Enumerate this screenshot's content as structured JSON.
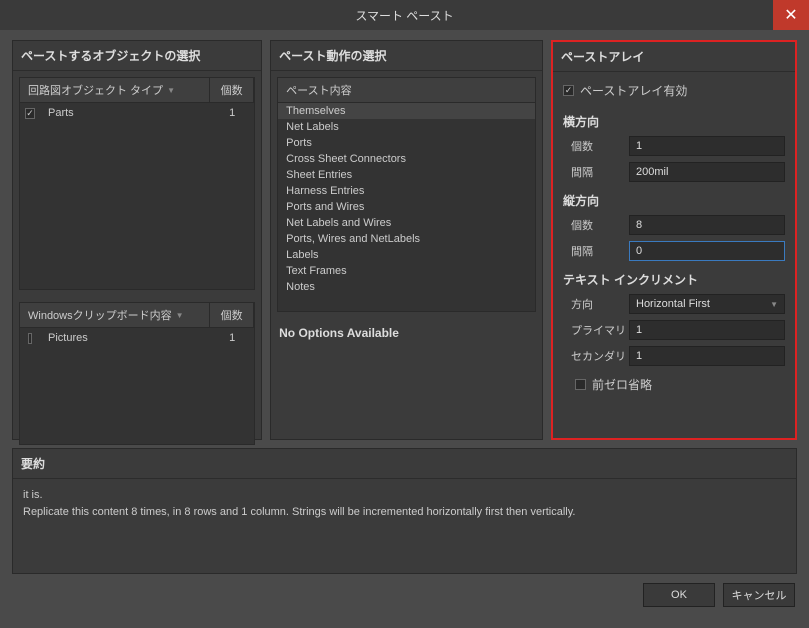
{
  "title": "スマート ペースト",
  "col1": {
    "header": "ペーストするオブジェクトの選択",
    "table1": {
      "headers": [
        "回路図オブジェクト タイプ",
        "個数"
      ],
      "rows": [
        {
          "checked": true,
          "name": "Parts",
          "count": "1"
        }
      ]
    },
    "table2": {
      "headers": [
        "Windowsクリップボード内容",
        "個数"
      ],
      "rows": [
        {
          "checked": false,
          "name": "Pictures",
          "count": "1"
        }
      ]
    }
  },
  "col2": {
    "header": "ペースト動作の選択",
    "listHeader": "ペースト内容",
    "items": [
      "Themselves",
      "Net Labels",
      "Ports",
      "Cross Sheet Connectors",
      "Sheet Entries",
      "Harness Entries",
      "Ports and Wires",
      "Net Labels and Wires",
      "Ports, Wires and NetLabels",
      "Labels",
      "Text Frames",
      "Notes"
    ],
    "noOptions": "No Options Available"
  },
  "col3": {
    "header": "ペーストアレイ",
    "enable": "ペーストアレイ有効",
    "horiz": {
      "label": "横方向",
      "countLabel": "個数",
      "count": "1",
      "spacingLabel": "間隔",
      "spacing": "200mil"
    },
    "vert": {
      "label": "縦方向",
      "countLabel": "個数",
      "count": "8",
      "spacingLabel": "間隔",
      "spacing": "0"
    },
    "textInc": {
      "label": "テキスト インクリメント",
      "dirLabel": "方向",
      "dir": "Horizontal First",
      "primaryLabel": "プライマリ",
      "primary": "1",
      "secondaryLabel": "セカンダリ",
      "secondary": "1",
      "leadingZero": "前ゼロ省略"
    }
  },
  "summary": {
    "header": "要約",
    "line1": "it is.",
    "line2": "Replicate this content 8 times, in 8 rows and 1 column. Strings will be incremented horizontally first then vertically."
  },
  "buttons": {
    "ok": "OK",
    "cancel": "キャンセル"
  }
}
